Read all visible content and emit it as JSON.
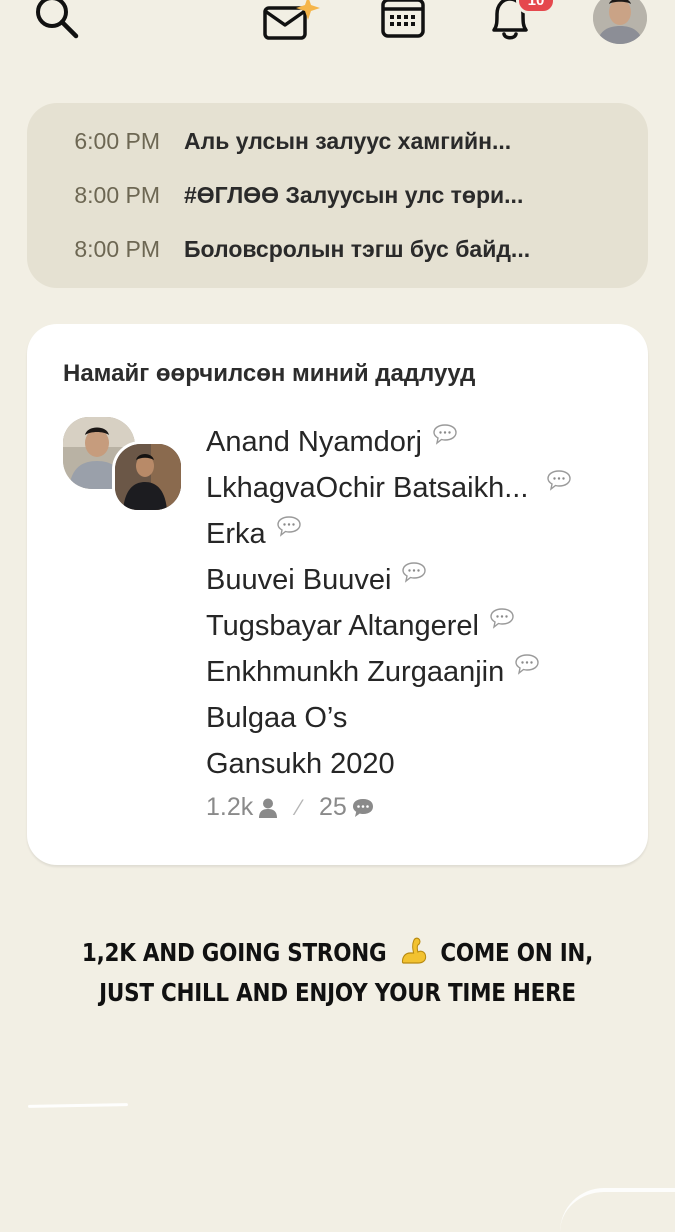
{
  "nav": {
    "notification_count": "10"
  },
  "icons": {
    "search": "search-icon",
    "mail": "mail-sparkle-icon",
    "calendar": "calendar-icon",
    "bell": "bell-icon",
    "chat": "chat-bubble-icon",
    "person": "person-icon",
    "arm": "flexed-biceps-emoji"
  },
  "colors": {
    "background": "#f2efe4",
    "schedule_bg": "#e5e1d2",
    "badge": "#e5484d",
    "card_bg": "#ffffff"
  },
  "schedule": [
    {
      "time": "6:00 PM",
      "title": "Аль улсын залуус хамгийн..."
    },
    {
      "time": "8:00 PM",
      "title": "#ӨГЛӨӨ Залуусын улс төри..."
    },
    {
      "time": "8:00 PM",
      "title": "Боловсролын тэгш бус байд..."
    }
  ],
  "club": {
    "title": "Намайг өөрчилсөн миний дадлууд",
    "speakers": [
      {
        "name": "Anand Nyamdorj",
        "speaking": true
      },
      {
        "name": "LkhagvaOchir Batsaikh...",
        "speaking": true
      },
      {
        "name": "Erka",
        "speaking": true
      },
      {
        "name": "Buuvei Buuvei",
        "speaking": true
      },
      {
        "name": "Tugsbayar Altangerel",
        "speaking": true
      },
      {
        "name": "Enkhmunkh Zurgaanjin",
        "speaking": true
      },
      {
        "name": "Bulgaa O’s",
        "speaking": false
      },
      {
        "name": "Gansukh 2020",
        "speaking": false
      }
    ],
    "listeners": "1.2k",
    "speakers_count": "25"
  },
  "caption": {
    "line1_before": "1,2K AND GOING STRONG",
    "line1_after": "COME ON IN,",
    "line2": "JUST CHILL AND ENJOY YOUR TIME HERE"
  }
}
